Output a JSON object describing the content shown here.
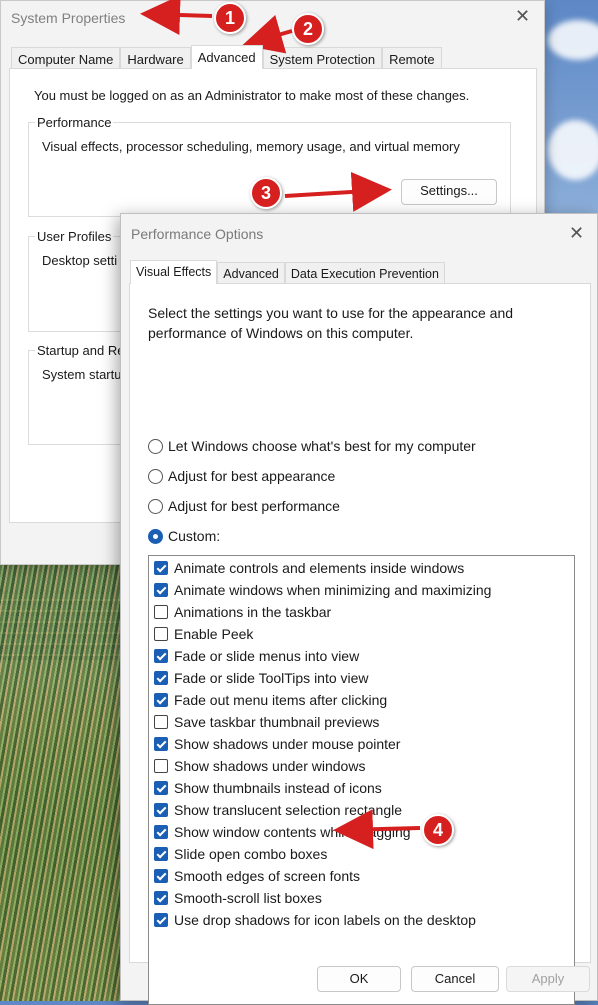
{
  "system_properties": {
    "title": "System Properties",
    "tabs": [
      "Computer Name",
      "Hardware",
      "Advanced",
      "System Protection",
      "Remote"
    ],
    "active_tab": "Advanced",
    "admin_message": "You must be logged on as an Administrator to make most of these changes.",
    "performance": {
      "label": "Performance",
      "description": "Visual effects, processor scheduling, memory usage, and virtual memory",
      "settings_button": "Settings..."
    },
    "user_profiles": {
      "label": "User Profiles",
      "description": "Desktop setti"
    },
    "startup": {
      "label": "Startup and Re",
      "description": "System startup"
    }
  },
  "performance_options": {
    "title": "Performance Options",
    "tabs": [
      "Visual Effects",
      "Advanced",
      "Data Execution Prevention"
    ],
    "active_tab": "Visual Effects",
    "description": "Select the settings you want to use for the appearance and performance of Windows on this computer.",
    "radios": [
      {
        "label": "Let Windows choose what's best for my computer",
        "selected": false
      },
      {
        "label": "Adjust for best appearance",
        "selected": false
      },
      {
        "label": "Adjust for best performance",
        "selected": false
      },
      {
        "label": "Custom:",
        "selected": true
      }
    ],
    "effects": [
      {
        "label": "Animate controls and elements inside windows",
        "checked": true
      },
      {
        "label": "Animate windows when minimizing and maximizing",
        "checked": true
      },
      {
        "label": "Animations in the taskbar",
        "checked": false
      },
      {
        "label": "Enable Peek",
        "checked": false
      },
      {
        "label": "Fade or slide menus into view",
        "checked": true
      },
      {
        "label": "Fade or slide ToolTips into view",
        "checked": true
      },
      {
        "label": "Fade out menu items after clicking",
        "checked": true
      },
      {
        "label": "Save taskbar thumbnail previews",
        "checked": false
      },
      {
        "label": "Show shadows under mouse pointer",
        "checked": true
      },
      {
        "label": "Show shadows under windows",
        "checked": false
      },
      {
        "label": "Show thumbnails instead of icons",
        "checked": true
      },
      {
        "label": "Show translucent selection rectangle",
        "checked": true
      },
      {
        "label": "Show window contents while dragging",
        "checked": true
      },
      {
        "label": "Slide open combo boxes",
        "checked": true
      },
      {
        "label": "Smooth edges of screen fonts",
        "checked": true
      },
      {
        "label": "Smooth-scroll list boxes",
        "checked": true
      },
      {
        "label": "Use drop shadows for icon labels on the desktop",
        "checked": true
      }
    ],
    "buttons": {
      "ok": "OK",
      "cancel": "Cancel",
      "apply": "Apply"
    }
  },
  "annotations": [
    "1",
    "2",
    "3",
    "4"
  ],
  "colors": {
    "accent": "#1a5fb4",
    "annotation": "#d62020"
  }
}
